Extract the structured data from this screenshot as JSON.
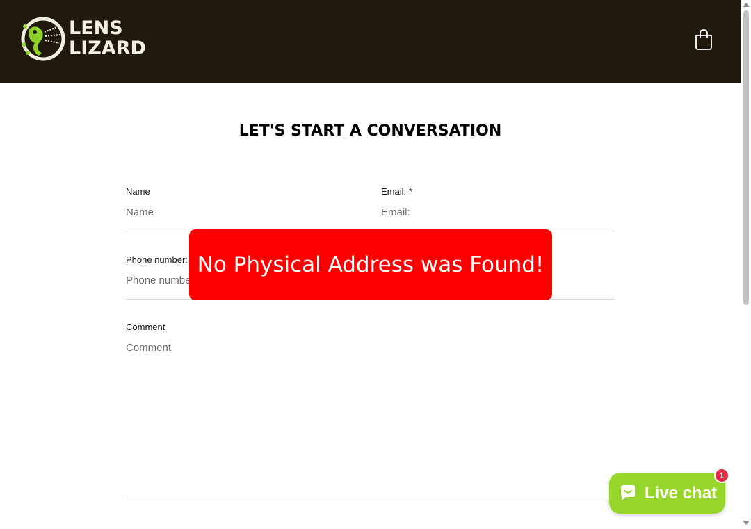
{
  "header": {
    "logo_line1": "LENS",
    "logo_line2": "LIZARD",
    "logo_icon": "lizard-camera-logo",
    "cart_icon": "shopping-bag-icon",
    "background_color": "#1f1a0c"
  },
  "main": {
    "title": "Let's start a conversation",
    "form": {
      "name_label": "Name",
      "name_placeholder": "Name",
      "email_label": "Email: *",
      "email_placeholder": "Email:",
      "phone_label": "Phone number:",
      "phone_placeholder": "Phone number",
      "comment_label": "Comment",
      "comment_placeholder": "Comment"
    }
  },
  "alert": {
    "message": "No Physical Address was Found!",
    "color": "#ff0000"
  },
  "chat": {
    "label": "Live chat",
    "badge_count": "1",
    "icon": "chat-bubble-icon",
    "color": "#97d62a",
    "badge_color": "#e42945"
  }
}
